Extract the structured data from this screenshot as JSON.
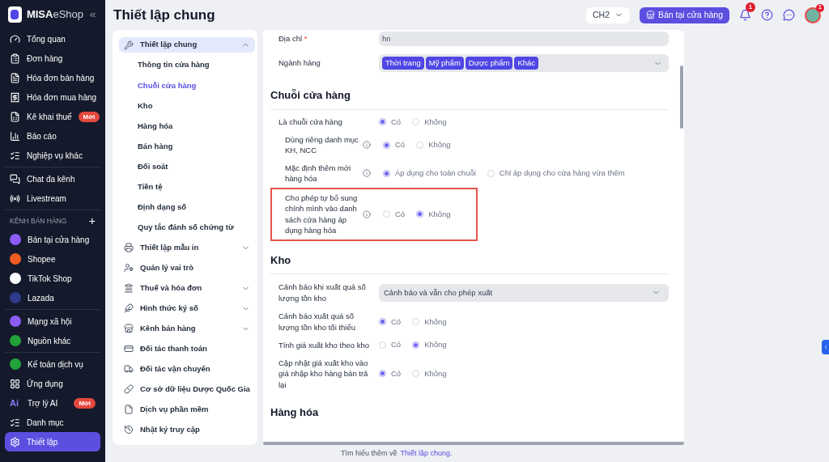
{
  "brand": {
    "name": "MISA",
    "product": "eShop"
  },
  "sidebar": {
    "groups": [
      {
        "items": [
          {
            "label": "Tổng quan",
            "selected": false
          },
          {
            "label": "Đơn hàng",
            "selected": false
          },
          {
            "label": "Hóa đơn bán hàng",
            "selected": false
          },
          {
            "label": "Hóa đơn mua hàng",
            "selected": false
          },
          {
            "label": "Kê khai thuế",
            "badge": "Mới",
            "selected": false
          },
          {
            "label": "Báo cáo",
            "selected": false
          },
          {
            "label": "Nghiệp vụ khác",
            "selected": false
          }
        ]
      },
      {
        "items": [
          {
            "label": "Chat đa kênh",
            "selected": false
          },
          {
            "label": "Livestream",
            "selected": false
          }
        ]
      },
      {
        "heading": "KÊNH BÁN HÀNG",
        "add": "+",
        "items": [
          {
            "label": "Bán tại cửa hàng",
            "color": "#8b5cf6",
            "selected": false
          },
          {
            "label": "Shopee",
            "color": "#f05d23",
            "selected": false
          },
          {
            "label": "TikTok Shop",
            "color": "#ffffff",
            "selected": false
          },
          {
            "label": "Lazada",
            "color": "#2e3a8c",
            "selected": false
          }
        ]
      },
      {
        "items": [
          {
            "label": "Mạng xã hội",
            "color": "#8b5cf6",
            "selected": false
          },
          {
            "label": "Nguồn khác",
            "color": "#22a33a",
            "selected": false
          }
        ]
      },
      {
        "items": [
          {
            "label": "Kế toán dịch vụ",
            "color": "#22a33a",
            "selected": false
          },
          {
            "label": "Ứng dụng",
            "selected": false
          },
          {
            "label": "Trợ lý AI",
            "icon_text": "Ai",
            "badge": "Mới",
            "selected": false
          },
          {
            "label": "Danh mục",
            "selected": false
          },
          {
            "label": "Thiết lập",
            "selected": true
          }
        ]
      }
    ]
  },
  "header": {
    "title": "Thiết lập chung",
    "branch": "CH2",
    "store_button": "Bán tại cửa hàng",
    "notifications": "1",
    "avatar_badge": "1"
  },
  "settings_nav": [
    {
      "label": "Thiết lập chung",
      "expanded": true,
      "selected": true,
      "children": [
        {
          "label": "Thông tin cửa hàng",
          "selected": false
        },
        {
          "label": "Chuỗi cửa hàng",
          "selected": true
        },
        {
          "label": "Kho",
          "selected": false
        },
        {
          "label": "Hàng hóa",
          "selected": false
        },
        {
          "label": "Bán hàng",
          "selected": false
        },
        {
          "label": "Đối soát",
          "selected": false
        },
        {
          "label": "Tiền tệ",
          "selected": false
        },
        {
          "label": "Định dạng số",
          "selected": false
        },
        {
          "label": "Quy tắc đánh số chứng từ",
          "selected": false
        }
      ]
    },
    {
      "label": "Thiết lập mẫu in",
      "expanded": false,
      "selected": false
    },
    {
      "label": "Quản lý vai trò",
      "selected": false
    },
    {
      "label": "Thuế và hóa đơn",
      "expanded": false,
      "selected": false
    },
    {
      "label": "Hình thức ký số",
      "expanded": false,
      "selected": false
    },
    {
      "label": "Kênh bán hàng",
      "expanded": false,
      "selected": false
    },
    {
      "label": "Đối tác thanh toán",
      "selected": false
    },
    {
      "label": "Đối tác vận chuyển",
      "selected": false
    },
    {
      "label": "Cơ sở dữ liệu Dược Quốc Gia",
      "selected": false
    },
    {
      "label": "Dịch vụ phần mềm",
      "selected": false
    },
    {
      "label": "Nhật ký truy cập",
      "selected": false
    }
  ],
  "content": {
    "sections": [
      {
        "rows": [
          {
            "kind": "input",
            "label": "Địa chỉ",
            "required_mark": "*",
            "value": "hn"
          },
          {
            "kind": "tags",
            "label": "Ngành hàng",
            "tags": [
              "Thời trang",
              "Mỹ phẩm",
              "Dược phẩm",
              "Khác"
            ]
          }
        ]
      },
      {
        "title": "Chuỗi cửa hàng",
        "rows": [
          {
            "kind": "radio",
            "label": "Là chuỗi cửa hàng",
            "options": [
              {
                "label": "Có",
                "selected": true
              },
              {
                "label": "Không",
                "selected": false
              }
            ],
            "children": [
              {
                "kind": "radio",
                "label": "Dùng riêng danh mục KH, NCC",
                "info": true,
                "options": [
                  {
                    "label": "Có",
                    "selected": true
                  },
                  {
                    "label": "Không",
                    "selected": false
                  }
                ]
              },
              {
                "kind": "radio",
                "label": "Mặc định thêm mới hàng hóa",
                "info": true,
                "options": [
                  {
                    "label": "Áp dụng cho toàn chuỗi",
                    "selected": true
                  },
                  {
                    "label": "Chỉ áp dụng cho cửa hàng vừa thêm",
                    "selected": false
                  }
                ]
              },
              {
                "kind": "radio",
                "label": "Cho phép tự bổ sung chính mình vào danh sách cửa hàng áp dụng hàng hóa",
                "info": true,
                "highlighted": true,
                "options": [
                  {
                    "label": "Có",
                    "selected": false
                  },
                  {
                    "label": "Không",
                    "selected": true
                  }
                ]
              }
            ]
          }
        ]
      },
      {
        "title": "Kho",
        "rows": [
          {
            "kind": "select",
            "label": "Cảnh báo khi xuất quá số lượng tồn kho",
            "value": "Cảnh báo và vẫn cho phép xuất"
          },
          {
            "kind": "radio",
            "label": "Cảnh báo xuất quá số lượng tồn kho tối thiểu",
            "options": [
              {
                "label": "Có",
                "selected": true
              },
              {
                "label": "Không",
                "selected": false
              }
            ]
          },
          {
            "kind": "radio",
            "label": "Tính giá xuất kho theo kho",
            "options": [
              {
                "label": "Có",
                "selected": false
              },
              {
                "label": "Không",
                "selected": true
              }
            ]
          },
          {
            "kind": "radio",
            "label": "Cập nhật giá xuất kho vào giá nhập kho hàng bán trả lại",
            "options": [
              {
                "label": "Có",
                "selected": true
              },
              {
                "label": "Không",
                "selected": false
              }
            ]
          }
        ]
      },
      {
        "title": "Hàng hóa"
      }
    ]
  },
  "footer": {
    "text": "Tìm hiểu thêm về",
    "link": "Thiết lập chung."
  }
}
